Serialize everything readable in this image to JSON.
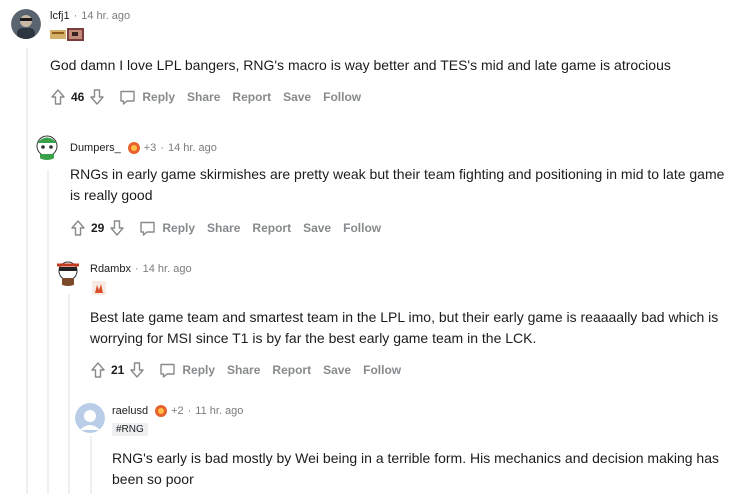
{
  "comments": [
    {
      "user": "lcfj1",
      "time": "14 hr. ago",
      "score": "46",
      "body": "God damn I love LPL bangers, RNG's macro is way better and TES's mid and late game is atrocious"
    },
    {
      "user": "Dumpers_",
      "award_count": "+3",
      "time": "14 hr. ago",
      "score": "29",
      "body": "RNGs in early game skirmishes are pretty weak but their team fighting and positioning in mid to late game is really good"
    },
    {
      "user": "Rdambx",
      "time": "14 hr. ago",
      "score": "21",
      "body": "Best late game team and smartest team in the LPL imo, but their early game is reaaaally bad which is worrying for MSI since T1 is by far the best early game team in the LCK."
    },
    {
      "user": "raelusd",
      "award_count": "+2",
      "time": "11 hr. ago",
      "flair": "#RNG",
      "body": "RNG's early is bad mostly by Wei being in a terrible form. His mechanics and decision making has been so poor"
    }
  ],
  "actions": {
    "reply": "Reply",
    "share": "Share",
    "report": "Report",
    "save": "Save",
    "follow": "Follow"
  },
  "separator": "·",
  "icons": [
    "upvote-icon",
    "downvote-icon",
    "comment-bubble-icon",
    "award-icon",
    "flair-image-icon"
  ],
  "colors": {
    "meta": "#7c7c7c",
    "action": "#878a8c",
    "thread": "#edeff1",
    "award": "#e8612c"
  }
}
